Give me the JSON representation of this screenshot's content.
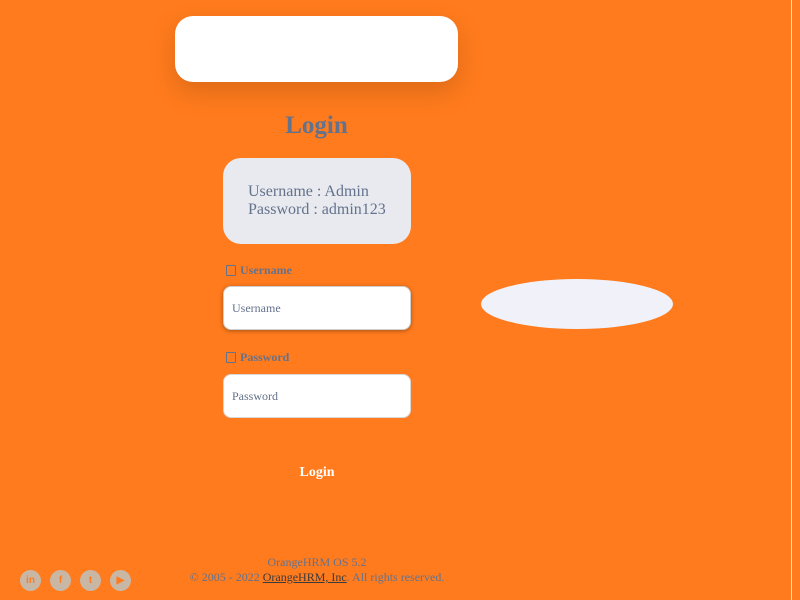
{
  "login": {
    "title": "Login",
    "credentials": {
      "username_line": "Username : Admin",
      "password_line": "Password : admin123"
    },
    "username": {
      "label": "Username",
      "placeholder": "Username",
      "icon": "person-icon"
    },
    "password": {
      "label": "Password",
      "placeholder": "Password",
      "icon": "lock-icon"
    },
    "submit_label": "Login"
  },
  "footer": {
    "version": "OrangeHRM OS 5.2",
    "copyright_prefix": "© 2005 - 2022 ",
    "company_link": "OrangeHRM, Inc",
    "copyright_suffix": ". All rights reserved."
  },
  "social": [
    {
      "name": "linkedin-icon",
      "glyph": "in"
    },
    {
      "name": "facebook-icon",
      "glyph": "f"
    },
    {
      "name": "twitter-icon",
      "glyph": "t"
    },
    {
      "name": "youtube-icon",
      "glyph": "▶"
    }
  ],
  "colors": {
    "background": "#ff7b1d",
    "text": "#64728c",
    "card": "#ffffff"
  }
}
